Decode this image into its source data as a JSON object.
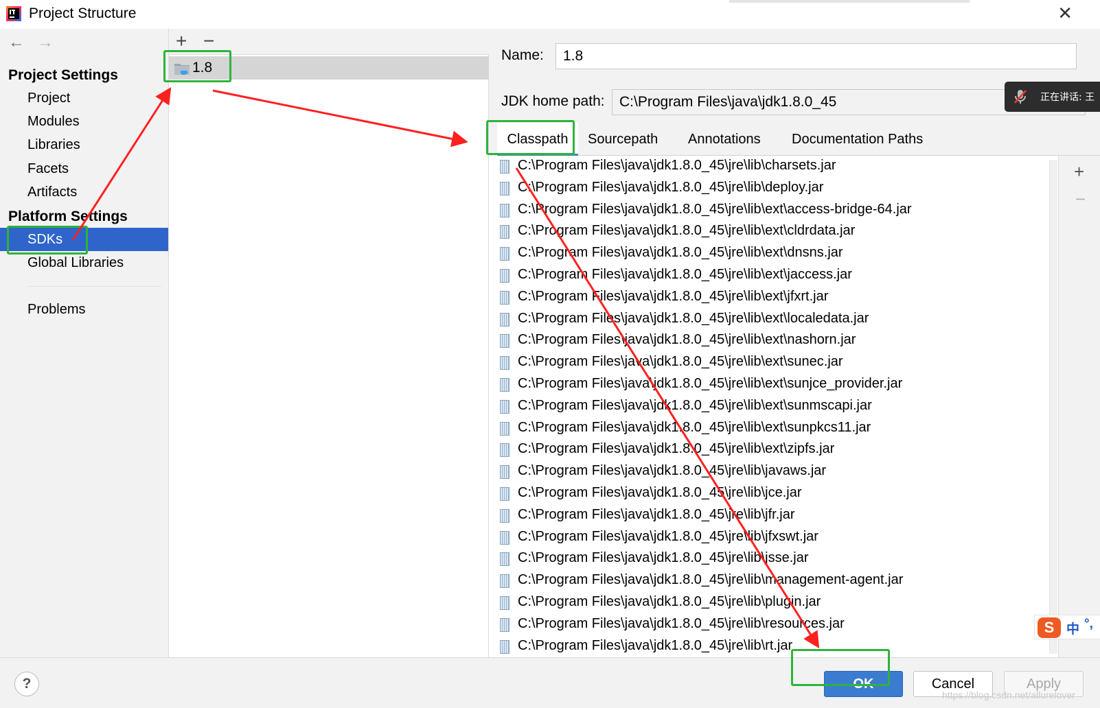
{
  "window": {
    "title": "Project Structure",
    "close_glyph": "✕"
  },
  "nav": {
    "back_glyph": "←",
    "forward_glyph": "→"
  },
  "sidebar": {
    "project_settings_header": "Project Settings",
    "platform_settings_header": "Platform Settings",
    "items": [
      {
        "label": "Project"
      },
      {
        "label": "Modules"
      },
      {
        "label": "Libraries"
      },
      {
        "label": "Facets"
      },
      {
        "label": "Artifacts"
      },
      {
        "label": "SDKs",
        "selected": true
      },
      {
        "label": "Global Libraries"
      },
      {
        "label": "Problems"
      }
    ]
  },
  "sdk_list": {
    "add_glyph": "+",
    "remove_glyph": "−",
    "items": [
      {
        "label": "1.8",
        "selected": true
      }
    ]
  },
  "sdk_detail": {
    "name_label": "Name:",
    "name_value": "1.8",
    "jdk_home_label": "JDK home path:",
    "jdk_home_value": "C:\\Program Files\\java\\jdk1.8.0_45",
    "tabs": [
      {
        "label": "Classpath",
        "active": true
      },
      {
        "label": "Sourcepath"
      },
      {
        "label": "Annotations"
      },
      {
        "label": "Documentation Paths"
      }
    ],
    "classpath_add_glyph": "+",
    "classpath_remove_glyph": "−",
    "classpath": [
      "C:\\Program Files\\java\\jdk1.8.0_45\\jre\\lib\\charsets.jar",
      "C:\\Program Files\\java\\jdk1.8.0_45\\jre\\lib\\deploy.jar",
      "C:\\Program Files\\java\\jdk1.8.0_45\\jre\\lib\\ext\\access-bridge-64.jar",
      "C:\\Program Files\\java\\jdk1.8.0_45\\jre\\lib\\ext\\cldrdata.jar",
      "C:\\Program Files\\java\\jdk1.8.0_45\\jre\\lib\\ext\\dnsns.jar",
      "C:\\Program Files\\java\\jdk1.8.0_45\\jre\\lib\\ext\\jaccess.jar",
      "C:\\Program Files\\java\\jdk1.8.0_45\\jre\\lib\\ext\\jfxrt.jar",
      "C:\\Program Files\\java\\jdk1.8.0_45\\jre\\lib\\ext\\localedata.jar",
      "C:\\Program Files\\java\\jdk1.8.0_45\\jre\\lib\\ext\\nashorn.jar",
      "C:\\Program Files\\java\\jdk1.8.0_45\\jre\\lib\\ext\\sunec.jar",
      "C:\\Program Files\\java\\jdk1.8.0_45\\jre\\lib\\ext\\sunjce_provider.jar",
      "C:\\Program Files\\java\\jdk1.8.0_45\\jre\\lib\\ext\\sunmscapi.jar",
      "C:\\Program Files\\java\\jdk1.8.0_45\\jre\\lib\\ext\\sunpkcs11.jar",
      "C:\\Program Files\\java\\jdk1.8.0_45\\jre\\lib\\ext\\zipfs.jar",
      "C:\\Program Files\\java\\jdk1.8.0_45\\jre\\lib\\javaws.jar",
      "C:\\Program Files\\java\\jdk1.8.0_45\\jre\\lib\\jce.jar",
      "C:\\Program Files\\java\\jdk1.8.0_45\\jre\\lib\\jfr.jar",
      "C:\\Program Files\\java\\jdk1.8.0_45\\jre\\lib\\jfxswt.jar",
      "C:\\Program Files\\java\\jdk1.8.0_45\\jre\\lib\\jsse.jar",
      "C:\\Program Files\\java\\jdk1.8.0_45\\jre\\lib\\management-agent.jar",
      "C:\\Program Files\\java\\jdk1.8.0_45\\jre\\lib\\plugin.jar",
      "C:\\Program Files\\java\\jdk1.8.0_45\\jre\\lib\\resources.jar",
      "C:\\Program Files\\java\\jdk1.8.0_45\\jre\\lib\\rt.jar"
    ]
  },
  "buttons": {
    "help": "?",
    "ok": "OK",
    "cancel": "Cancel",
    "apply": "Apply"
  },
  "overlays": {
    "speaking_notification": "正在讲话: 王",
    "ime_mode": "中",
    "ime_punct": "°,",
    "sogou_glyph": "S",
    "watermark": "https://blog.csdn.net/allurelover"
  },
  "icons": [
    "intellij-app-icon",
    "back-arrow-icon",
    "forward-arrow-icon",
    "close-icon",
    "add-icon",
    "remove-icon",
    "sdk-folder-icon",
    "jar-icon",
    "muted-mic-icon",
    "sogou-ime-icon",
    "help-icon"
  ],
  "colors": {
    "selection": "#2f65ca",
    "ok_button": "#3b7cd0",
    "highlight_box": "#2eb33a",
    "annotation_arrow": "#ff2020",
    "panel_bg": "#f2f2f2"
  }
}
